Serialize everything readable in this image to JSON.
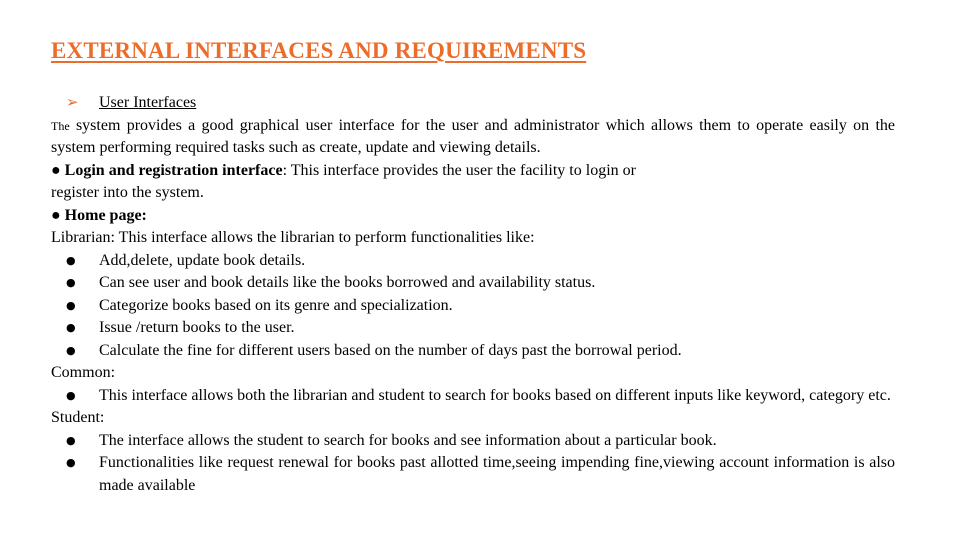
{
  "title": "EXTERNAL INTERFACES AND REQUIREMENTS",
  "section": {
    "arrow_glyph": "➢",
    "label": "User Interfaces"
  },
  "intro": {
    "lead": "The",
    "rest": " system provides a good graphical user interface for the user and administrator which allows them to operate easily on the system performing required tasks such as create, update and viewing  details."
  },
  "login": {
    "marker": "●",
    "heading": "Login and registration interface",
    "text_line1": ": This interface provides the user the facility to login or",
    "text_line2": "register into the system."
  },
  "home": {
    "marker": "●",
    "heading": "Home page:"
  },
  "librarian": {
    "label": "Librarian:  This interface allows the librarian  to perform functionalities  like:",
    "items": [
      "Add,delete, update book details.",
      "Can see user and book details like  the books borrowed and availability  status.",
      "Categorize  books based on its genre and specialization.",
      "Issue /return books to the user.",
      "Calculate  the fine for different users based on the number of days past the borrowal period."
    ]
  },
  "common": {
    "label": "Common:",
    "items": [
      "This interface allows both the librarian and student to search for books based on different inputs like keyword, category etc."
    ]
  },
  "student": {
    "label": "Student:",
    "items": [
      "The interface allows the student to search for books and see information  about a particular  book.",
      "Functionalities like request renewal for books past allotted time,seeing impending fine,viewing account information  is also made available"
    ]
  },
  "bullet_glyph": "●",
  "colors": {
    "accent": "#ec6c2a",
    "text": "#000000"
  }
}
